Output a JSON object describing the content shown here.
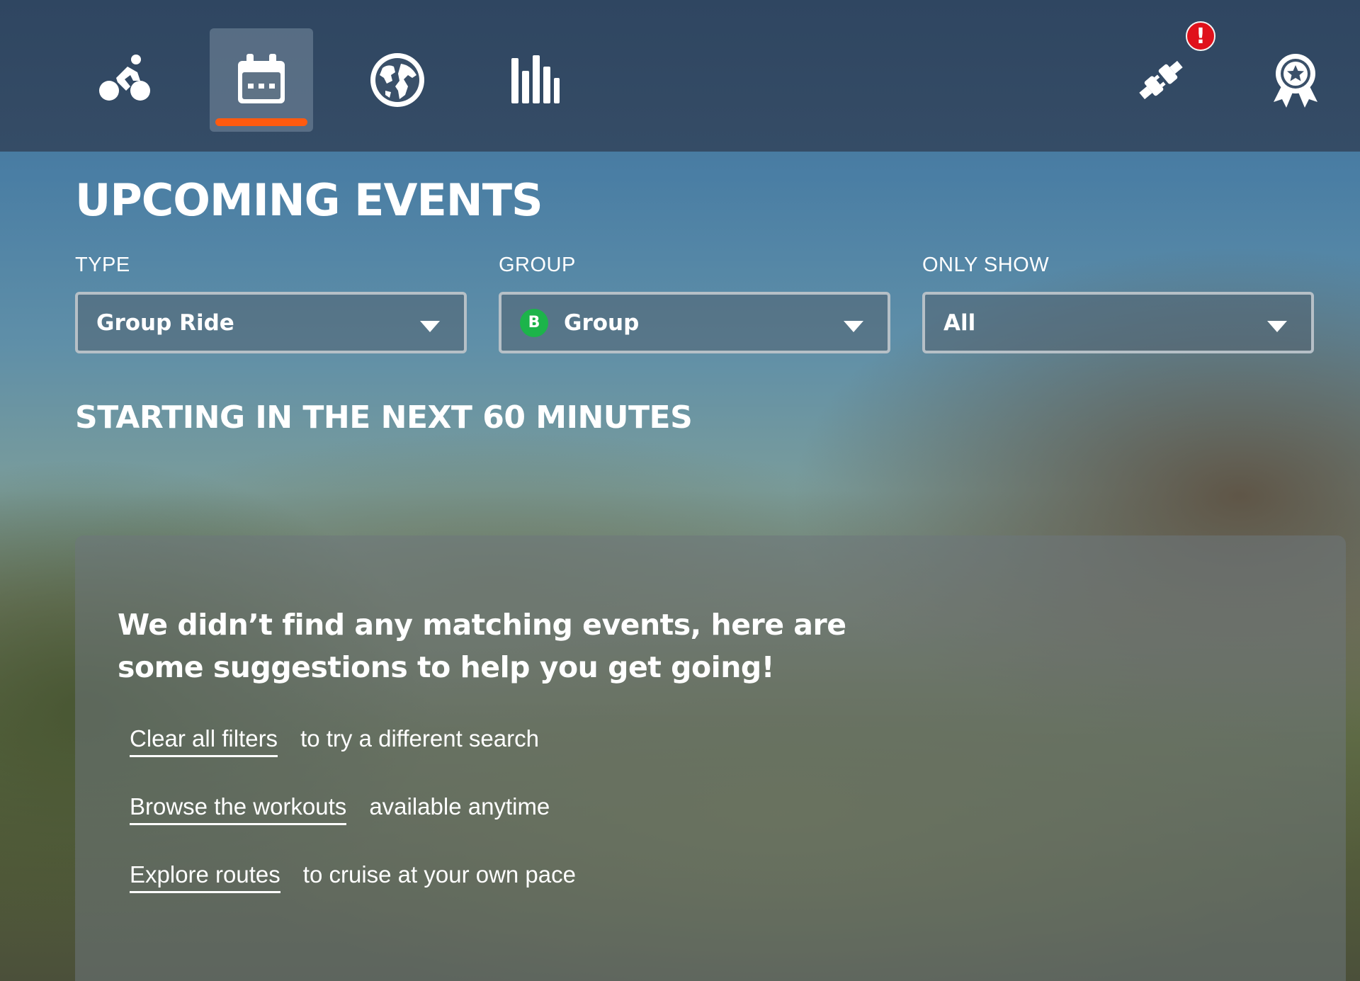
{
  "nav": {
    "items": [
      {
        "id": "ride",
        "icon": "cyclist-icon",
        "active": false
      },
      {
        "id": "events",
        "icon": "calendar-icon",
        "active": true
      },
      {
        "id": "world",
        "icon": "globe-icon",
        "active": false
      },
      {
        "id": "stats",
        "icon": "bar-chart-icon",
        "active": false
      }
    ],
    "right": [
      {
        "id": "pairing",
        "icon": "plug-connection-icon",
        "badge": "!"
      },
      {
        "id": "achievements",
        "icon": "award-ribbon-icon"
      }
    ],
    "accent_color": "#ff5a0f",
    "badge_color": "#e0111b"
  },
  "page": {
    "title": "UPCOMING EVENTS"
  },
  "filters": {
    "type": {
      "label": "TYPE",
      "value": "Group Ride"
    },
    "group": {
      "label": "GROUP",
      "value": "Group",
      "badge": "B",
      "badge_color": "#1cb44a"
    },
    "only_show": {
      "label": "ONLY SHOW",
      "value": "All"
    }
  },
  "section": {
    "title": "STARTING IN THE NEXT 60 MINUTES"
  },
  "suggestions": {
    "heading_line1": "We didn’t find any matching events, here are",
    "heading_line2": "some suggestions to help you get going!",
    "items": [
      {
        "link": "Clear all filters",
        "text": "to try a different search"
      },
      {
        "link": "Browse the workouts",
        "text": "available anytime"
      },
      {
        "link": "Explore routes",
        "text": "to cruise at your own pace"
      }
    ]
  }
}
